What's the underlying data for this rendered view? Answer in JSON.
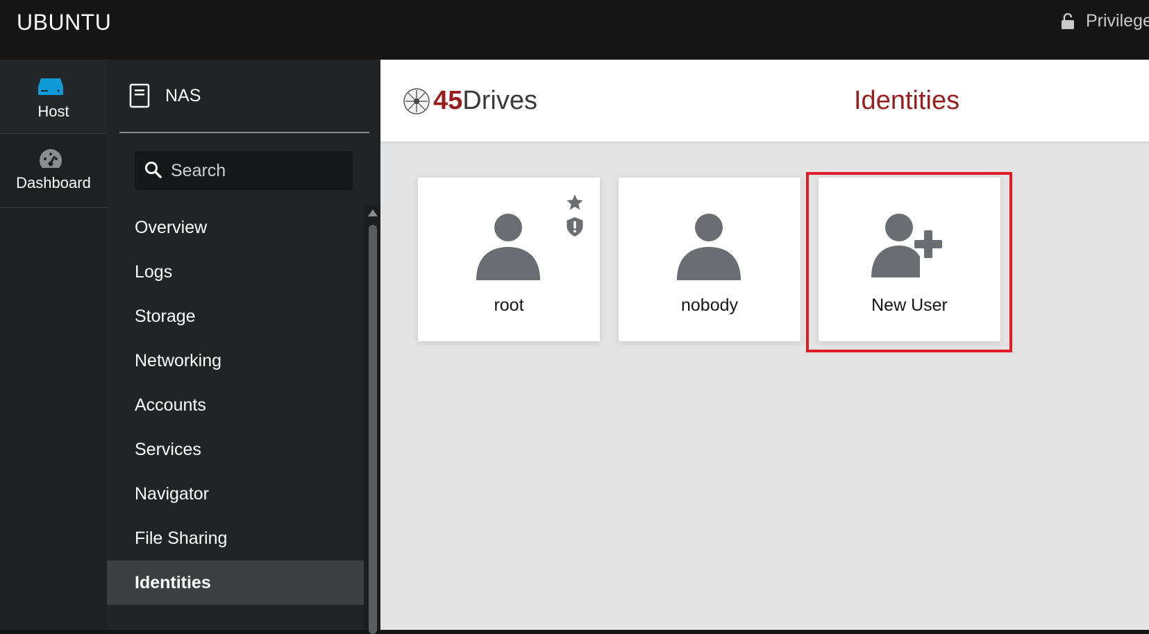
{
  "topbar": {
    "host_name": "UBUNTU",
    "privilege_label": "Privileged",
    "lock_icon": "lock-open-icon"
  },
  "rail": {
    "items": [
      {
        "label": "Host",
        "icon": "server-icon",
        "active": true
      },
      {
        "label": "Dashboard",
        "icon": "dashboard-gauge-icon",
        "active": false
      }
    ]
  },
  "nav": {
    "header": {
      "label": "NAS",
      "icon": "document-icon"
    },
    "search": {
      "placeholder": "Search",
      "icon": "search-icon"
    },
    "items": [
      {
        "label": "Overview"
      },
      {
        "label": "Logs"
      },
      {
        "label": "Storage"
      },
      {
        "label": "Networking"
      },
      {
        "label": "Accounts"
      },
      {
        "label": "Services"
      },
      {
        "label": "Navigator"
      },
      {
        "label": "File Sharing"
      },
      {
        "label": "Identities",
        "active": true
      }
    ]
  },
  "header": {
    "logo_number": "45",
    "logo_word": "Drives",
    "page_title": "Identities"
  },
  "users": [
    {
      "name": "root",
      "badges": [
        "star-icon",
        "shield-icon"
      ]
    },
    {
      "name": "nobody",
      "badges": []
    }
  ],
  "new_user": {
    "label": "New User",
    "icon": "user-plus-icon"
  },
  "colors": {
    "accent_red": "#9b1c1c",
    "highlight_red": "#e01b24",
    "avatar_gray": "#6a6e73",
    "active_nav_bg": "#3c3f42",
    "host_icon_blue": "#0f9bd7"
  }
}
